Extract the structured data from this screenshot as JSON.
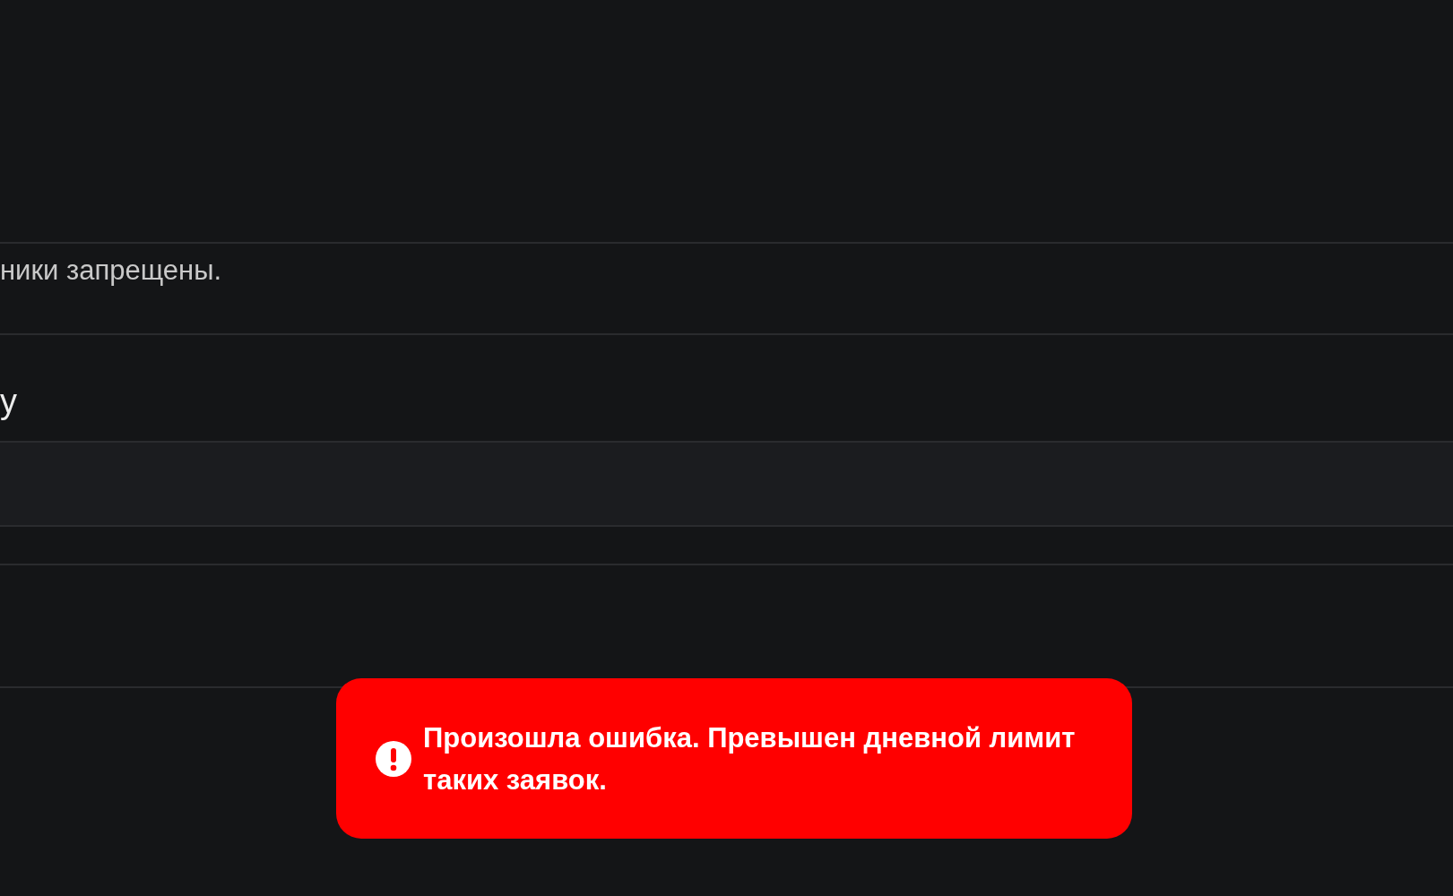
{
  "notice": {
    "text": "ники запрещены."
  },
  "section_heading": {
    "text": "у"
  },
  "toast": {
    "kind": "error",
    "message": "Произошла ошибка. Превышен дневной лимит таких заявок."
  }
}
